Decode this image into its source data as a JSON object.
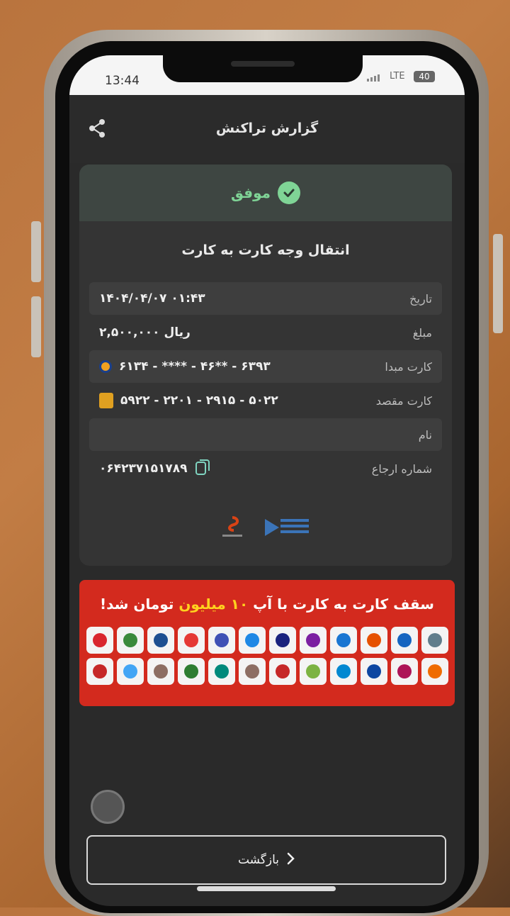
{
  "status_bar": {
    "time": "13:44",
    "network": "LTE",
    "battery": "40"
  },
  "header": {
    "title": "گزارش تراکنش",
    "share_icon": "share-icon"
  },
  "result": {
    "status": "موفق",
    "icon": "check-circle-icon",
    "color": "#7fd496"
  },
  "transaction": {
    "type": "انتقال وجه کارت به کارت",
    "rows": [
      {
        "label": "تاریخ",
        "value": "۱۴۰۴/۰۴/۰۷ ۰۱:۴۳"
      },
      {
        "label": "مبلغ",
        "value": "۲,۵۰۰,۰۰۰ ریال"
      },
      {
        "label": "کارت مبدا",
        "value": "۶۱۳۴ - **** - ۴۶** - ۶۳۹۳"
      },
      {
        "label": "کارت مقصد",
        "value": "۵۹۲۲ - ۲۲۰۱ - ۲۹۱۵ - ۵۰۲۲"
      },
      {
        "label": "نام",
        "value": ""
      },
      {
        "label": "شماره ارجاع",
        "value": "۰۶۴۲۳۷۱۵۱۷۸۹"
      }
    ]
  },
  "banner": {
    "text_before": "سقف کارت به کارت با آپ ",
    "highlight": "۱۰ میلیون",
    "text_after": " تومان شد!",
    "background": "#d32a1e",
    "bank_colors": [
      "#d9262e",
      "#3a8a3c",
      "#1d4f91",
      "#e53935",
      "#3f51b5",
      "#1e88e5",
      "#1a237e",
      "#7b1fa2",
      "#1976d2",
      "#e65100",
      "#1565c0",
      "#607d8b",
      "#c62828",
      "#42a5f5",
      "#8d6e63",
      "#2e7d32",
      "#00897b",
      "#8d6e63",
      "#c62828",
      "#7cb342",
      "#0288d1",
      "#0d47a1",
      "#ad1457",
      "#ef6c00"
    ]
  },
  "footer": {
    "back_label": "بازگشت"
  }
}
